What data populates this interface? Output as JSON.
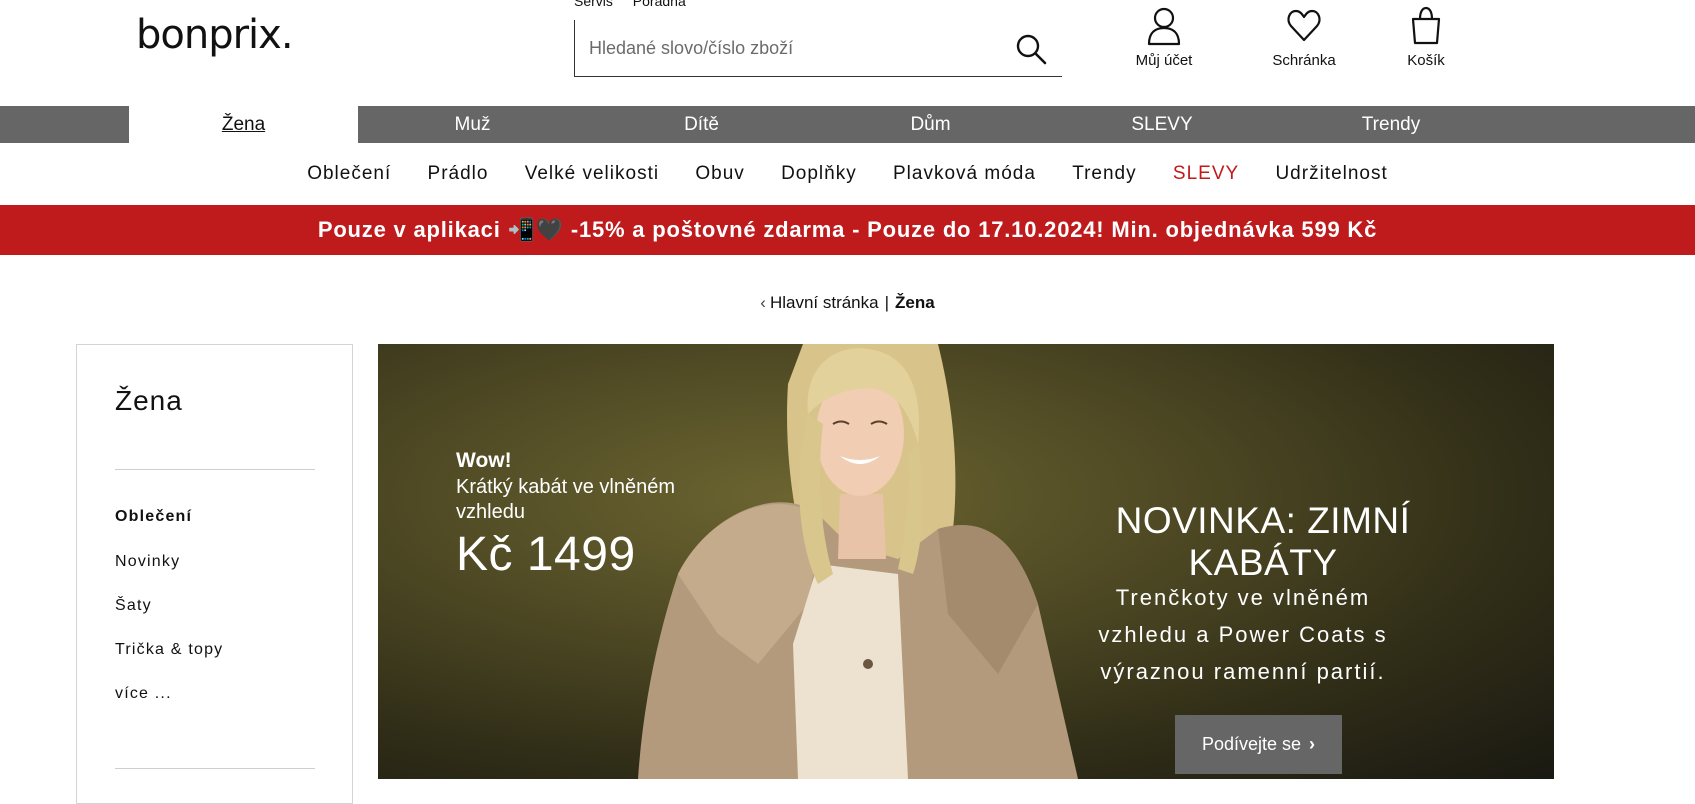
{
  "header": {
    "logo": "bonprix.",
    "service_links": [
      "Servis",
      "Poradna"
    ],
    "search_placeholder": "Hledané slovo/číslo zboží",
    "actions": {
      "account": "Můj účet",
      "wishlist": "Schránka",
      "cart": "Košík"
    }
  },
  "main_nav": {
    "tabs": [
      {
        "label": "Žena",
        "active": true
      },
      {
        "label": "Muž"
      },
      {
        "label": "Dítě"
      },
      {
        "label": "Dům"
      },
      {
        "label": "SLEVY"
      },
      {
        "label": "Trendy"
      }
    ]
  },
  "sub_nav": {
    "items": [
      "Oblečení",
      "Prádlo",
      "Velké velikosti",
      "Obuv",
      "Doplňky",
      "Plavková móda",
      "Trendy",
      "SLEVY",
      "Udržitelnost"
    ]
  },
  "promo": {
    "text": "Pouze v aplikaci 📲🖤 -15% a poštovné zdarma  - Pouze do 17.10.2024! Min. objednávka 599 Kč"
  },
  "breadcrumb": {
    "home": "Hlavní stránka",
    "separator": "|",
    "current": "Žena"
  },
  "sidebar": {
    "title": "Žena",
    "section": "Oblečení",
    "items": [
      "Novinky",
      "Šaty",
      "Trička & topy",
      "více ..."
    ]
  },
  "hero": {
    "offer_wow": "Wow!",
    "offer_desc": "Krátký kabát ve vlněném vzhledu",
    "offer_price": "Kč 1499",
    "headline": "NOVINKA: ZIMNÍ KABÁTY",
    "subline": "Trenčkoty ve vlněném vzhledu a Power Coats s výraznou ramenní partií.",
    "cta": "Podívejte se"
  },
  "colors": {
    "nav_gray": "#666666",
    "promo_red": "#bf1a1c",
    "sale_red": "#c01a1e"
  }
}
